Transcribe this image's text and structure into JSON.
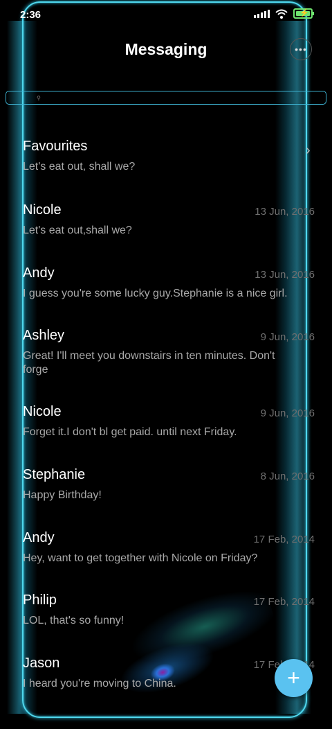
{
  "status_bar": {
    "time": "2:36"
  },
  "header": {
    "title": "Messaging",
    "more_icon": "more-horizontal-icon"
  },
  "search": {
    "placeholder": "",
    "icon": "search-icon"
  },
  "favourites": {
    "name": "Favourites",
    "snippet": "Let's eat out, shall we?"
  },
  "conversations": [
    {
      "name": "Nicole",
      "date": "13 Jun, 2016",
      "snippet": "Let's eat out,shall we?"
    },
    {
      "name": "Andy",
      "date": "13 Jun, 2016",
      "snippet": "I guess you're some lucky guy.Stephanie is a nice girl."
    },
    {
      "name": "Ashley",
      "date": "9 Jun, 2016",
      "snippet": "Great! I'll meet you downstairs in ten minutes. Don't forge"
    },
    {
      "name": "Nicole",
      "date": "9 Jun, 2016",
      "snippet": "Forget it.I don't bl get paid. until next Friday."
    },
    {
      "name": "Stephanie",
      "date": "8 Jun, 2016",
      "snippet": "Happy Birthday!"
    },
    {
      "name": "Andy",
      "date": "17 Feb, 2014",
      "snippet": "Hey, want to get together with Nicole on Friday?"
    },
    {
      "name": "Philip",
      "date": "17 Feb, 2014",
      "snippet": "LOL, that's so funny!"
    },
    {
      "name": "Jason",
      "date": "17 Feb, 2014",
      "snippet": "I heard you're moving to China."
    }
  ],
  "fab": {
    "label": "+",
    "icon": "plus-icon"
  },
  "colors": {
    "frame": "#4fd8ee",
    "fab": "#5ac2f0",
    "background": "#000000"
  }
}
